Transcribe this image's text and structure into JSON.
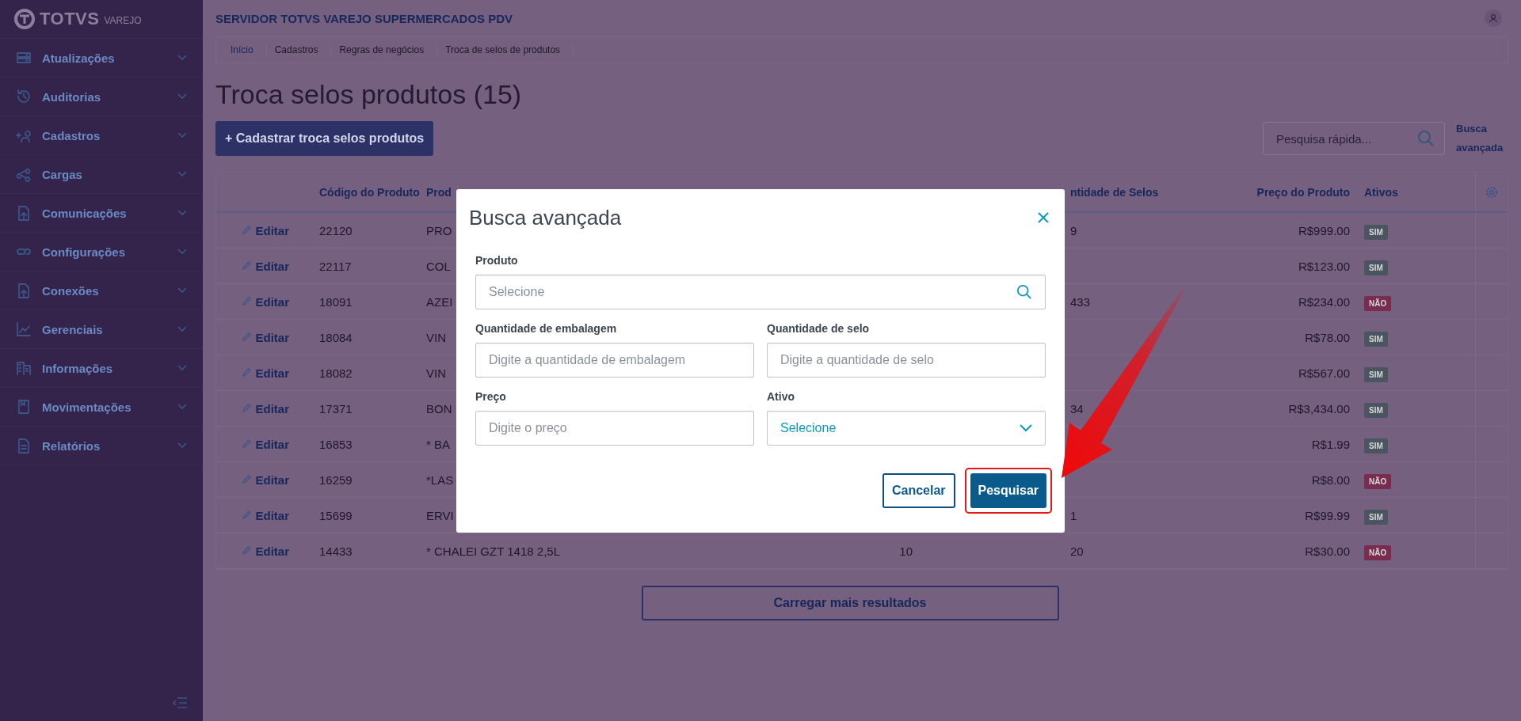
{
  "brand": {
    "name": "TOTVS",
    "sub": "VAREJO"
  },
  "sidebar": {
    "items": [
      {
        "label": "Atualizações"
      },
      {
        "label": "Auditorias"
      },
      {
        "label": "Cadastros"
      },
      {
        "label": "Cargas"
      },
      {
        "label": "Comunicações"
      },
      {
        "label": "Configurações"
      },
      {
        "label": "Conexões"
      },
      {
        "label": "Gerenciais"
      },
      {
        "label": "Informações"
      },
      {
        "label": "Movimentações"
      },
      {
        "label": "Relatórios"
      }
    ]
  },
  "header": {
    "title": "SERVIDOR TOTVS VAREJO SUPERMERCADOS PDV"
  },
  "breadcrumb": [
    "Início",
    "Cadastros",
    "Regras de negócios",
    "Troca de selos de produtos"
  ],
  "page": {
    "title": "Troca selos produtos (15)",
    "add_button": "+ Cadastrar troca selos produtos",
    "search_placeholder": "Pesquisa rápida...",
    "advanced_link": "Busca avançada"
  },
  "table": {
    "columns": {
      "code": "Código do Produto",
      "product": "Prod",
      "seals": "ntidade de Selos",
      "price": "Preço do Produto",
      "active": "Ativos"
    },
    "rows": [
      {
        "action": "Editar",
        "code": "22120",
        "product": "PRO",
        "seals": "9",
        "price": "R$999.00",
        "active": {
          "label": "SIM",
          "color": "#4a5560"
        }
      },
      {
        "action": "Editar",
        "code": "22117",
        "product": "COL",
        "price": "R$123.00",
        "active": {
          "label": "SIM",
          "color": "#4a5560"
        }
      },
      {
        "action": "Editar",
        "code": "18091",
        "product": "AZEI",
        "seals": "433",
        "price": "R$234.00",
        "active": {
          "label": "NÃO",
          "color": "#7a2c4e"
        }
      },
      {
        "action": "Editar",
        "code": "18084",
        "product": "VIN",
        "price": "R$78.00",
        "active": {
          "label": "SIM",
          "color": "#4a5560"
        }
      },
      {
        "action": "Editar",
        "code": "18082",
        "product": "VIN",
        "price": "R$567.00",
        "active": {
          "label": "SIM",
          "color": "#4a5560"
        }
      },
      {
        "action": "Editar",
        "code": "17371",
        "product": "BON",
        "seals": "34",
        "price": "R$3,434.00",
        "active": {
          "label": "SIM",
          "color": "#4a5560"
        }
      },
      {
        "action": "Editar",
        "code": "16853",
        "product": "* BA",
        "price": "R$1.99",
        "active": {
          "label": "SIM",
          "color": "#4a5560"
        }
      },
      {
        "action": "Editar",
        "code": "16259",
        "product": "*LAS",
        "price": "R$8.00",
        "active": {
          "label": "NÃO",
          "color": "#7a2c4e"
        }
      },
      {
        "action": "Editar",
        "code": "15699",
        "product": "ERVI",
        "seals": "1",
        "price": "R$99.99",
        "active": {
          "label": "SIM",
          "color": "#4a5560"
        }
      },
      {
        "action": "Editar",
        "code": "14433",
        "product": "* CHALEI GZT 1418 2,5L",
        "packaging": "10",
        "seals": "20",
        "price": "R$30.00",
        "active": {
          "label": "NÃO",
          "color": "#7a2c4e"
        }
      }
    ],
    "load_more": "Carregar mais resultados"
  },
  "modal": {
    "title": "Busca avançada",
    "fields": [
      {
        "label": "Produto",
        "placeholder": "Selecione",
        "kind": "search"
      },
      {
        "label": "Quantidade de embalagem",
        "placeholder": "Digite a quantidade de embalagem",
        "kind": "text"
      },
      {
        "label": "Quantidade de selo",
        "placeholder": "Digite a quantidade de selo",
        "kind": "text"
      },
      {
        "label": "Preço",
        "placeholder": "Digite o preço",
        "kind": "text"
      },
      {
        "label": "Ativo",
        "value": "Selecione",
        "kind": "select"
      }
    ],
    "buttons": [
      {
        "label": "Cancelar",
        "kind": "secondary"
      },
      {
        "label": "Pesquisar",
        "kind": "primary",
        "highlighted": true
      }
    ]
  }
}
